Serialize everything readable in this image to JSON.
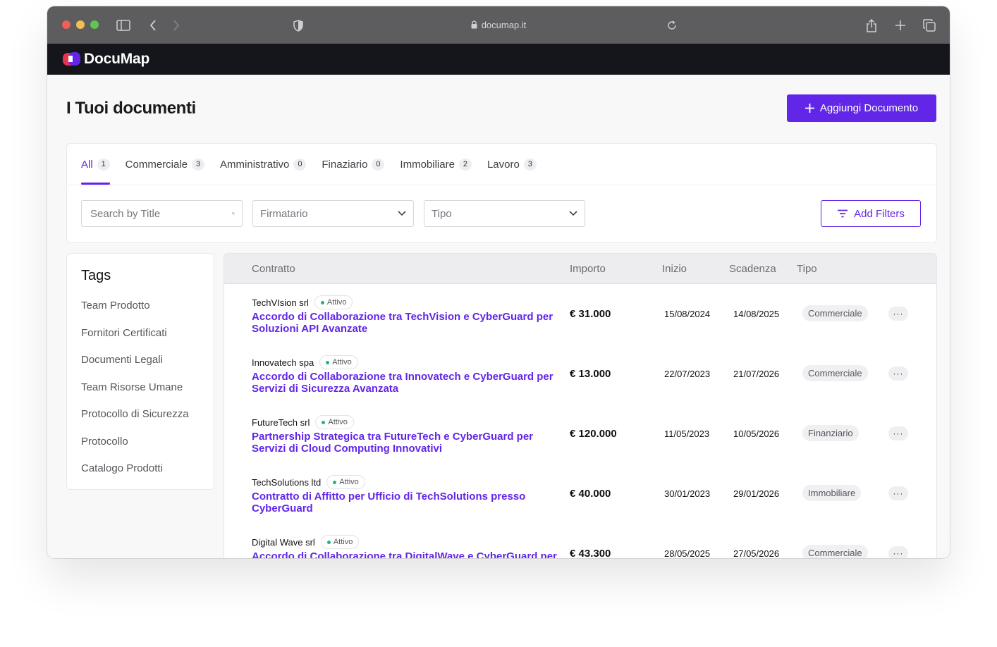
{
  "browser": {
    "url": "documap.it"
  },
  "app": {
    "name": "DocuMap"
  },
  "page": {
    "title": "I Tuoi documenti",
    "add_button_label": "Aggiungi Documento"
  },
  "tabs": [
    {
      "label": "All",
      "count": "1",
      "active": true
    },
    {
      "label": "Commerciale",
      "count": "3"
    },
    {
      "label": "Amministrativo",
      "count": "0"
    },
    {
      "label": "Finaziario",
      "count": "0"
    },
    {
      "label": "Immobiliare",
      "count": "2"
    },
    {
      "label": "Lavoro",
      "count": "3"
    }
  ],
  "filters": {
    "search_placeholder": "Search by Title",
    "firmatario_label": "Firmatario",
    "tipo_label": "Tipo",
    "add_filters_label": "Add Filters"
  },
  "tags": {
    "title": "Tags",
    "items": [
      "Team Prodotto",
      "Fornitori Certificati",
      "Documenti Legali",
      "Team Risorse Umane",
      "Protocollo di Sicurezza",
      "Protocollo",
      "Catalogo Prodotti"
    ]
  },
  "table": {
    "headers": {
      "contratto": "Contratto",
      "importo": "Importo",
      "inizio": "Inizio",
      "scadenza": "Scadenza",
      "tipo": "Tipo"
    },
    "rows": [
      {
        "company": "TechVIsion srl",
        "status": "Attivo",
        "title": "Accordo di Collaborazione tra TechVision e CyberGuard per Soluzioni API Avanzate",
        "amount": "€ 31.000",
        "start": "15/08/2024",
        "end": "14/08/2025",
        "type": "Commerciale"
      },
      {
        "company": "Innovatech spa",
        "status": "Attivo",
        "title": "Accordo di Collaborazione tra Innovatech e CyberGuard per Servizi di Sicurezza Avanzata",
        "amount": "€ 13.000",
        "start": "22/07/2023",
        "end": "21/07/2026",
        "type": "Commerciale"
      },
      {
        "company": "FutureTech srl",
        "status": "Attivo",
        "title": "Partnership Strategica tra FutureTech e CyberGuard per Servizi di Cloud Computing Innovativi",
        "amount": "€ 120.000",
        "start": "11/05/2023",
        "end": "10/05/2026",
        "type": "Finanziario"
      },
      {
        "company": "TechSolutions ltd",
        "status": "Attivo",
        "title": "Contratto di Affitto per Ufficio di TechSolutions presso CyberGuard",
        "amount": "€ 40.000",
        "start": "30/01/2023",
        "end": "29/01/2026",
        "type": "Immobiliare"
      },
      {
        "company": "Digital Wave srl",
        "status": "Attivo",
        "title": "Accordo di Collaborazione tra DigitalWave e CyberGuard per",
        "amount": "€ 43.300",
        "start": "28/05/2025",
        "end": "27/05/2026",
        "type": "Commerciale"
      }
    ],
    "more_label": "···"
  },
  "colors": {
    "accent": "#6226e8",
    "status_active": "#1fb57a",
    "appbar": "#15161b"
  }
}
